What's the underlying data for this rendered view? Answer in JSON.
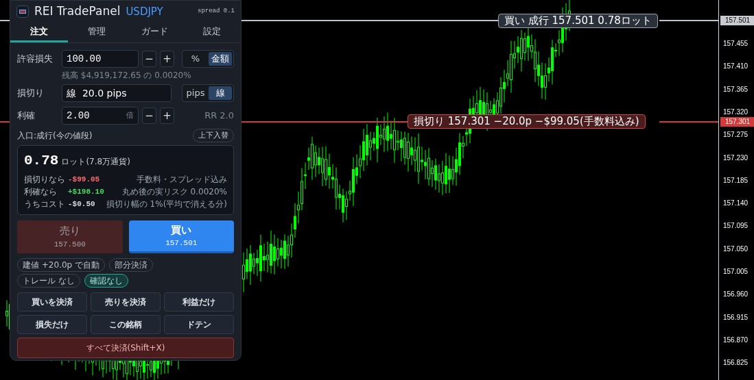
{
  "panel": {
    "title": "REI TradePanel",
    "symbol": "USDJPY",
    "spread": "spread 0.1",
    "tabs": [
      {
        "label": "注文",
        "selected": true
      },
      {
        "label": "管理",
        "selected": false
      },
      {
        "label": "ガード",
        "selected": false
      },
      {
        "label": "設定",
        "selected": false
      }
    ],
    "risk": {
      "label": "許容損失",
      "value": "100.00",
      "minus": "−",
      "plus": "+",
      "modes": [
        {
          "label": "%",
          "selected": false
        },
        {
          "label": "金額",
          "selected": true
        }
      ],
      "hint": "残高 $4,919,172.65 の 0.0020%"
    },
    "stop": {
      "label": "損切り",
      "value": "線  20.0 pips",
      "modes": [
        {
          "label": "pips",
          "selected": false
        },
        {
          "label": "線",
          "selected": true
        }
      ]
    },
    "take": {
      "label": "利確",
      "value": "2.00",
      "suffix": "倍",
      "minus": "−",
      "plus": "+",
      "rr": "RR 2.0"
    },
    "entry": {
      "label": "入口:成行(今の値段)",
      "swap_button": "上下入替"
    },
    "summary": {
      "lots": "0.78",
      "unit": "ロット(7.8万通貨)",
      "rows": [
        {
          "label": "損切りなら",
          "value": "-$99.05",
          "color": "#ff6b6b",
          "note": "手数料・スプレッド込み"
        },
        {
          "label": "利確なら",
          "value": "+$198.10",
          "color": "#4cd964",
          "note": "丸め後の実リスク 0.0020%"
        },
        {
          "label": "うちコスト",
          "value": "-$0.50",
          "color": "#d6dbe2",
          "note": "損切り幅の 1%(平均で消える分)"
        }
      ]
    },
    "sell": {
      "label": "売り",
      "price": "157.500"
    },
    "buy": {
      "label": "買い",
      "price": "157.501"
    },
    "chips": [
      [
        {
          "label": "建値 +20.0p で自動",
          "on": false
        },
        {
          "label": "部分決済",
          "on": false
        }
      ],
      [
        {
          "label": "トレール なし",
          "on": false
        },
        {
          "label": "確認なし",
          "on": true
        }
      ]
    ],
    "actions": [
      "買いを決済",
      "売りを決済",
      "利益だけ",
      "損失だけ",
      "この銘柄",
      "ドテン"
    ],
    "close_all": "すべて決済(Shift+X)"
  },
  "chart": {
    "buy_line": {
      "label": "買い 成行 157.501  0.78ロット",
      "price": "157.501"
    },
    "stop_line": {
      "label": "損切り 157.301  −20.0p  −$99.05(手数料込み)",
      "price": "157.301"
    },
    "axis_labels": [
      "157.455",
      "157.410",
      "157.365",
      "157.320",
      "157.275",
      "157.230",
      "157.185",
      "157.140",
      "157.095",
      "157.050",
      "157.005",
      "156.960",
      "156.915",
      "156.870",
      "156.825"
    ]
  }
}
